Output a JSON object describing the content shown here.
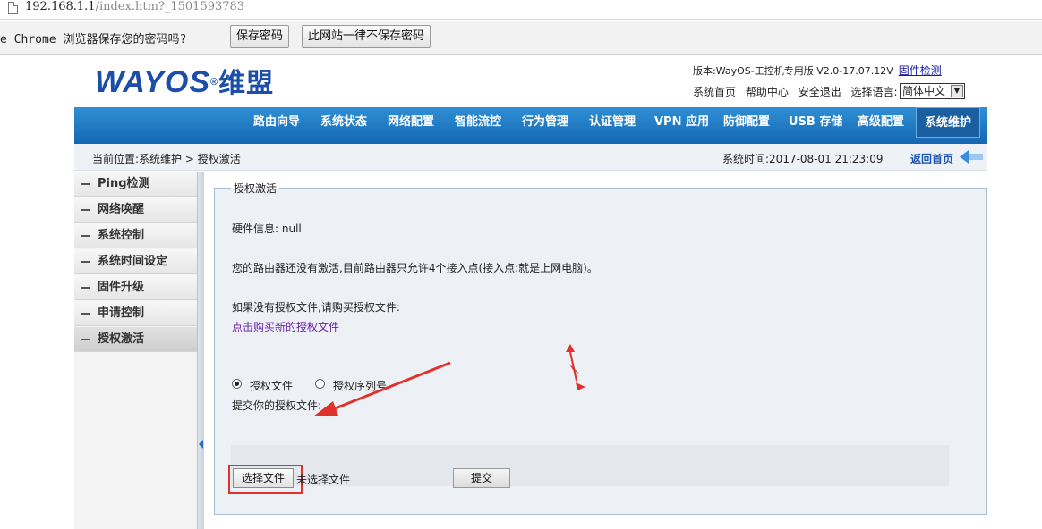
{
  "browser": {
    "url_main": "192.168.1.1",
    "url_rest": "/index.htm?_1501593783"
  },
  "infobar": {
    "message": "e Chrome 浏览器保存您的密码吗?",
    "save_label": "保存密码",
    "never_label": "此网站一律不保存密码"
  },
  "header": {
    "logo_text": "WAYOS",
    "logo_reg": "®",
    "logo_cn": "维盟",
    "version": "版本:WayOS-工控机专用版 V2.0-17.07.12V",
    "firmware_check": "固件检测",
    "links": [
      "系统首页",
      "帮助中心",
      "安全退出",
      "选择语言:"
    ],
    "language": "简体中文"
  },
  "nav": {
    "items": [
      "路由向导",
      "系统状态",
      "网络配置",
      "智能流控",
      "行为管理",
      "认证管理",
      "VPN 应用",
      "防御配置",
      "USB 存储",
      "高级配置",
      "系统维护"
    ],
    "active_index": 10
  },
  "crumb": {
    "location": "当前位置:系统维护 > 授权激活",
    "time": "系统时间:2017-08-01 21:23:09",
    "back": "返回首页"
  },
  "sidebar": {
    "items": [
      "Ping检测",
      "网络唤醒",
      "系统控制",
      "系统时间设定",
      "固件升级",
      "申请控制",
      "授权激活"
    ],
    "active_index": 6
  },
  "panel": {
    "legend": "授权激活",
    "hw_info": "硬件信息: null",
    "notice": "您的路由器还没有激活,目前路由器只允许4个接入点(接入点:就是上网电脑)。",
    "no_file": "如果没有授权文件,请购买授权文件:",
    "buy_link": "点击购买新的授权文件 ",
    "radio_file": "授权文件",
    "radio_serial": "授权序列号",
    "submit_prompt": "提交你的授权文件:",
    "choose_file": "选择文件",
    "no_file_chosen": "未选择文件",
    "submit": "提交"
  },
  "colors": {
    "nav_blue": "#1467b3",
    "logo_blue": "#1b4ea8",
    "annotation_red": "#e0312b"
  }
}
